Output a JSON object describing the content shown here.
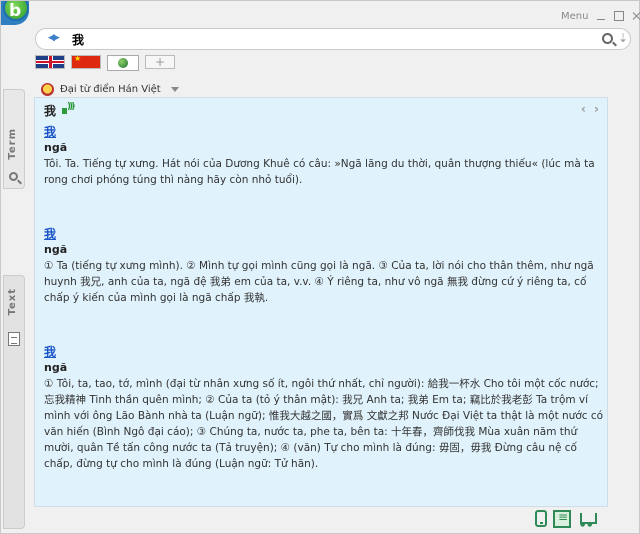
{
  "window": {
    "menu_label": "Menu",
    "controls": [
      "minimize-icon",
      "maximize-icon",
      "close-icon"
    ]
  },
  "search": {
    "value": "我",
    "icons": [
      "back-forward-icon",
      "search-icon",
      "download-icon"
    ]
  },
  "tabs": [
    {
      "name": "english-flag",
      "active": false
    },
    {
      "name": "chinese-flag",
      "active": false
    },
    {
      "name": "globe",
      "active": true
    },
    {
      "name": "add-tab",
      "label": "+",
      "active": false
    }
  ],
  "sidebar": {
    "term_label": "Term",
    "text_label": "Text"
  },
  "dictionary": {
    "selected": "Đại từ điển Hán Việt"
  },
  "result": {
    "word": "我",
    "nav": "‹ ›",
    "entries": [
      {
        "head": "我",
        "pron": "ngã",
        "def": "Tôi. Ta. Tiếng tự xưng. Hát nói của Dương Khuê có câu: »Ngã lãng du thời, quân thượng thiếu« (lúc mà ta rong chơi phóng túng thì nàng hãy còn nhỏ tuổi)."
      },
      {
        "head": "我",
        "pron": "ngã",
        "def": "① Ta (tiếng tự xưng mình). ② Mình tự gọi mình cũng gọi là ngã. ③ Của ta, lời nói cho thân thêm, như ngã huynh 我兄, anh của ta, ngã đệ 我弟 em của ta, v.v. ④ Ý riêng ta, như vô ngã 無我 đừng cứ ý riêng ta, cố chấp ý kiến của mình gọi là ngã chấp 我執."
      },
      {
        "head": "我",
        "pron": "ngã",
        "def": "① Tôi, ta, tao, tớ, mình (đại từ nhân xưng số ít, ngôi thứ nhất, chỉ người): 給我一杯水 Cho tôi một cốc nước; 忘我精神 Tinh thần quên mình; ② Của ta (tỏ ý thân mật): 我兄 Anh ta; 我弟 Em ta; 竊比於我老彭 Ta trộm ví mình với ông Lão Bành nhà ta (Luận ngữ); 惟我大越之國，實爲 文獻之邦 Nước Đại Việt ta thật là một nước có văn hiến (Bình Ngô đại cáo); ③ Chúng ta, nước ta, phe ta, bên ta: 十年春，齊師伐我 Mùa xuân năm thứ mười, quân Tề tấn công nước ta (Tả truyện); ④ (văn) Tự cho mình là đúng: 毋固，毋我 Đừng câu nệ cố chấp, đừng tự cho mình là đúng (Luận ngữ: Tử hãn)."
      }
    ]
  },
  "footer": {
    "icons": [
      "mobile-icon",
      "book-icon",
      "cart-icon"
    ]
  }
}
